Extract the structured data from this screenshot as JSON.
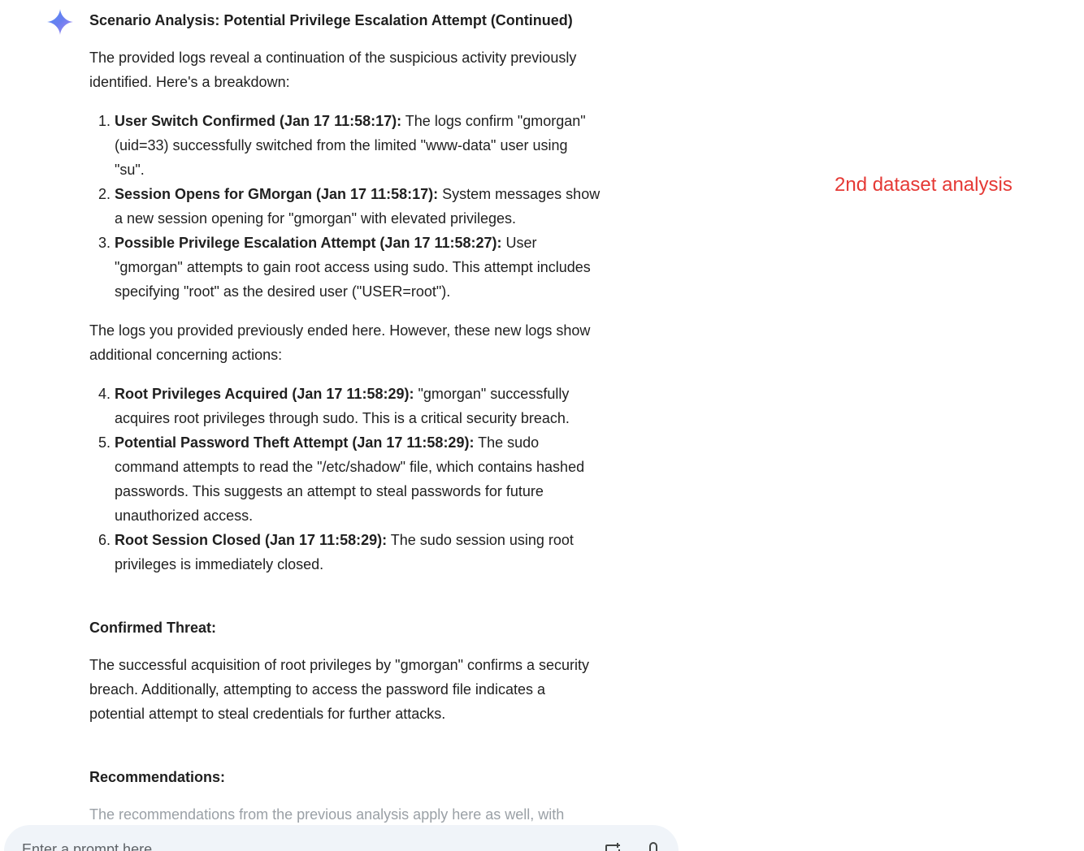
{
  "response": {
    "title": "Scenario Analysis: Potential Privilege Escalation Attempt (Continued)",
    "intro": "The provided logs reveal a continuation of the suspicious activity previously identified. Here's a breakdown:",
    "items_part1": [
      {
        "label": "User Switch Confirmed (Jan 17 11:58:17):",
        "text": " The logs confirm \"gmorgan\" (uid=33) successfully switched from the limited \"www-data\" user using \"su\"."
      },
      {
        "label": "Session Opens for GMorgan (Jan 17 11:58:17):",
        "text": " System messages show a new session opening for \"gmorgan\" with elevated privileges."
      },
      {
        "label": "Possible Privilege Escalation Attempt (Jan 17 11:58:27):",
        "text": " User \"gmorgan\" attempts to gain root access using sudo. This attempt includes specifying \"root\" as the desired user (\"USER=root\")."
      }
    ],
    "middle": "The logs you provided previously ended here.  However, these new logs show additional concerning actions:",
    "items_part2": [
      {
        "label": "Root Privileges Acquired (Jan 17 11:58:29):",
        "text": " \"gmorgan\" successfully acquires root privileges through sudo. This is a critical security breach."
      },
      {
        "label": "Potential Password Theft Attempt (Jan 17 11:58:29):",
        "text": " The sudo command attempts to read the \"/etc/shadow\" file, which contains hashed passwords. This suggests an attempt to steal passwords for future unauthorized access."
      },
      {
        "label": "Root Session Closed (Jan 17 11:58:29):",
        "text": " The sudo session using root privileges is immediately closed."
      }
    ],
    "threat_heading": "Confirmed Threat:",
    "threat_text": "The successful acquisition of root privileges by \"gmorgan\" confirms a security breach.  Additionally, attempting to access the password file indicates a potential attempt to steal credentials for further attacks.",
    "recommendations_heading": "Recommendations:",
    "recommendations_text": "The recommendations from the previous analysis apply here as well, with"
  },
  "annotation": {
    "text": "2nd dataset analysis",
    "color": "#e53935"
  },
  "prompt": {
    "placeholder": "Enter a prompt here",
    "image_icon": "add-image-icon",
    "mic_icon": "microphone-icon"
  },
  "colors": {
    "prompt_bg": "#f0f4f9",
    "text": "#1f1f1f",
    "faded_text": "#9aa0a6"
  }
}
